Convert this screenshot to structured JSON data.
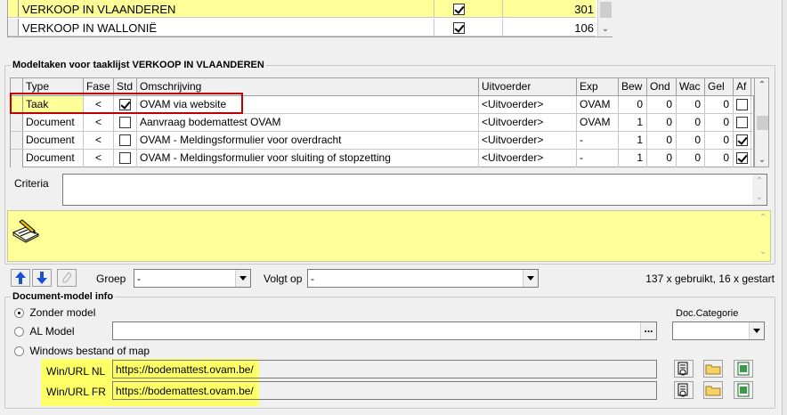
{
  "top_list": {
    "rows": [
      {
        "name": "VERKOOP IN VLAANDEREN",
        "checked": true,
        "count": "301",
        "selected": true
      },
      {
        "name": "VERKOOP IN WALLONIË",
        "checked": true,
        "count": "106",
        "selected": false
      }
    ]
  },
  "modeltaken": {
    "title": "Modeltaken voor taaklijst VERKOOP IN VLAANDEREN",
    "columns": [
      "Type",
      "Fase",
      "Std",
      "Omschrijving",
      "Uitvoerder",
      "Exp",
      "Bew",
      "Ond",
      "Wac",
      "Gel",
      "Af"
    ],
    "rows": [
      {
        "type": "Taak",
        "fase": "<",
        "std": true,
        "omschrijving": "OVAM via website",
        "uitvoerder": "<Uitvoerder>",
        "exp": "OVAM",
        "bew": "0",
        "ond": "0",
        "wac": "0",
        "gel": "0",
        "af": false
      },
      {
        "type": "Document",
        "fase": "<",
        "std": false,
        "omschrijving": "Aanvraag bodemattest OVAM",
        "uitvoerder": "<Uitvoerder>",
        "exp": "OVAM",
        "bew": "1",
        "ond": "0",
        "wac": "0",
        "gel": "0",
        "af": false
      },
      {
        "type": "Document",
        "fase": "<",
        "std": false,
        "omschrijving": "OVAM - Meldingsformulier voor overdracht",
        "uitvoerder": "<Uitvoerder>",
        "exp": "-",
        "bew": "1",
        "ond": "0",
        "wac": "0",
        "gel": "0",
        "af": true
      },
      {
        "type": "Document",
        "fase": "<",
        "std": false,
        "omschrijving": "OVAM - Meldingsformulier voor sluiting of stopzetting",
        "uitvoerder": "<Uitvoerder>",
        "exp": "-",
        "bew": "1",
        "ond": "0",
        "wac": "0",
        "gel": "0",
        "af": true
      }
    ]
  },
  "criteria": {
    "label": "Criteria",
    "value": ""
  },
  "toolbar": {
    "groep_label": "Groep",
    "groep_value": "-",
    "volgt_op_label": "Volgt op",
    "volgt_op_value": "-",
    "usage": "137 x gebruikt, 16 x gestart"
  },
  "document_model": {
    "title": "Document-model info",
    "options": [
      "Zonder model",
      "AL Model",
      "Windows bestand of map"
    ],
    "selected_option": "Zonder model",
    "al_model_value": "",
    "doc_categorie_label": "Doc.Categorie",
    "doc_categorie_value": "",
    "ellipsis": "...",
    "url_nl_label": "Win/URL NL",
    "url_nl_value": "https://bodemattest.ovam.be/",
    "url_fr_label": "Win/URL FR",
    "url_fr_value": "https://bodemattest.ovam.be/"
  },
  "colors": {
    "highlight_yellow": "#ffff99",
    "red_outline": "#c00000",
    "arrow_blue": "#1a4fd6"
  }
}
